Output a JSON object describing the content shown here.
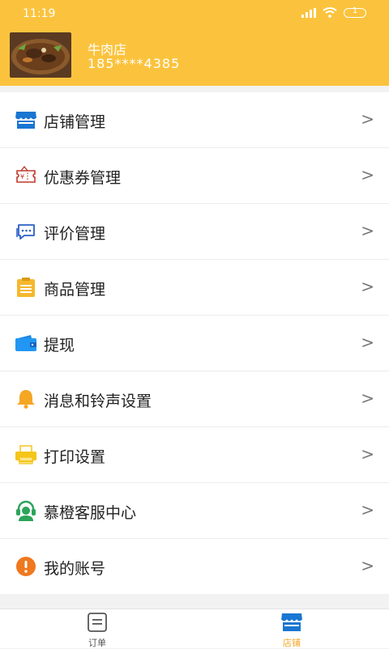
{
  "status_bar": {
    "time": "11:19",
    "battery": "1"
  },
  "store": {
    "name": "牛肉店",
    "phone": "185****4385"
  },
  "menu": [
    {
      "label": "店铺管理",
      "icon": "store-icon"
    },
    {
      "label": "优惠券管理",
      "icon": "coupon-icon"
    },
    {
      "label": "评价管理",
      "icon": "chat-icon"
    },
    {
      "label": "商品管理",
      "icon": "clipboard-icon"
    },
    {
      "label": "提现",
      "icon": "wallet-icon"
    },
    {
      "label": "消息和铃声设置",
      "icon": "bell-icon"
    },
    {
      "label": "打印设置",
      "icon": "printer-icon"
    },
    {
      "label": "慕橙客服中心",
      "icon": "headset-icon"
    },
    {
      "label": "我的账号",
      "icon": "alert-icon"
    }
  ],
  "chevron": ">",
  "tabs": [
    {
      "label": "订单",
      "icon": "order-icon",
      "active": false
    },
    {
      "label": "店铺",
      "icon": "store-icon",
      "active": true
    }
  ],
  "colors": {
    "brand": "#fbc33d",
    "active_tab": "#f5a623",
    "inactive_tab": "#555555"
  }
}
